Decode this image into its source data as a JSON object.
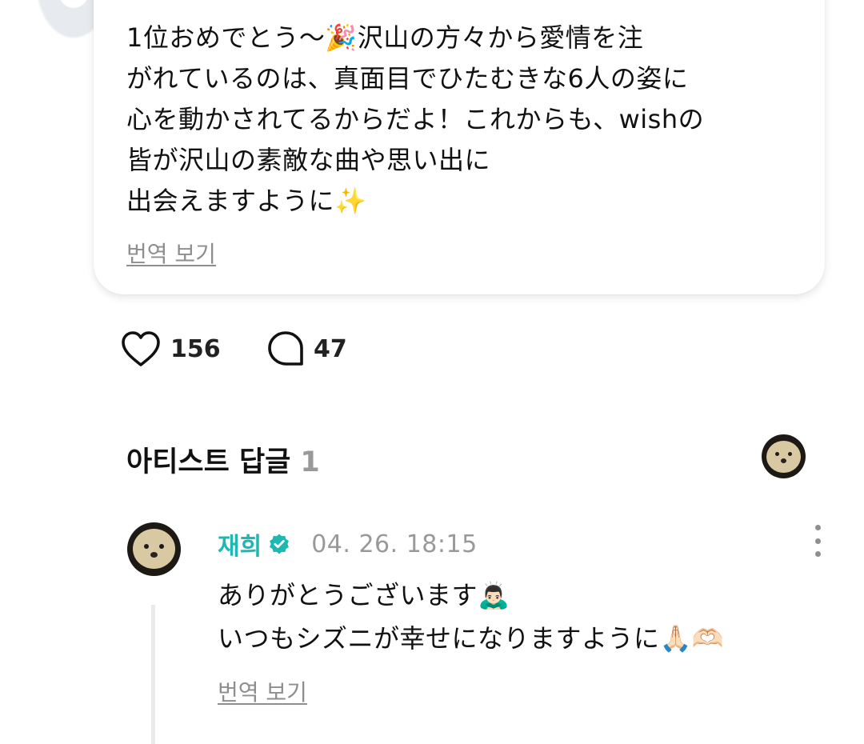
{
  "post": {
    "text": "1位おめでとう〜🎉沢山の方々から愛情を注\nがれているのは、真面目でひたむきな6人の姿に\n心を動かされてるからだよ！これからも、wishの\n皆が沢山の素敵な曲や思い出に\n出会えますように✨",
    "translate_label": "번역 보기",
    "like_count": "156",
    "comment_count": "47",
    "like_icon": "heart-icon",
    "comment_icon": "speech-bubble-icon"
  },
  "artist_replies": {
    "title": "아티스트 답글",
    "count": "1"
  },
  "reply": {
    "author": "재희",
    "timestamp": "04. 26. 18:15",
    "text": "ありがとうございます🙇🏻‍♂️\nいつもシズニが幸せになりますように🙏🏻🫶🏻",
    "translate_label": "번역 보기",
    "verified_icon": "verified-badge-icon",
    "more_icon": "more-vertical-icon"
  },
  "colors": {
    "accent": "#1fb7b1",
    "muted": "#999999"
  }
}
